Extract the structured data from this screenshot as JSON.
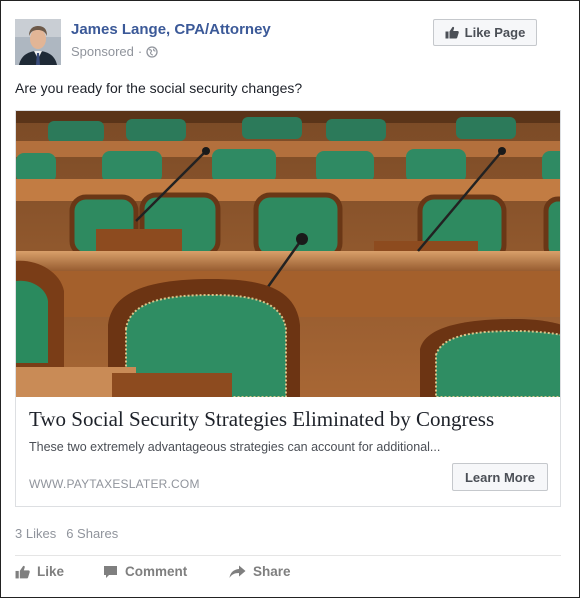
{
  "post": {
    "author": "James Lange, CPA/Attorney",
    "sponsored_label": "Sponsored",
    "meta_separator": "·",
    "like_page_label": "Like Page",
    "text": "Are you ready for the social security changes?"
  },
  "link_card": {
    "headline": "Two Social Security Strategies Eliminated by Congress",
    "description": "These two extremely advantageous strategies can account for additional...",
    "domain": "WWW.PAYTAXESLATER.COM",
    "cta_label": "Learn More"
  },
  "engagement": {
    "likes": "3 Likes",
    "shares": "6 Shares"
  },
  "actions": {
    "like": "Like",
    "comment": "Comment",
    "share": "Share"
  },
  "icons": {
    "thumbs_up": "thumbs-up-icon",
    "globe": "globe-icon",
    "comment": "comment-icon",
    "share": "share-arrow-icon"
  },
  "colors": {
    "author_link": "#3b5998",
    "muted": "#90949c",
    "text": "#1d2129",
    "action_gray": "#7f7f7f"
  }
}
